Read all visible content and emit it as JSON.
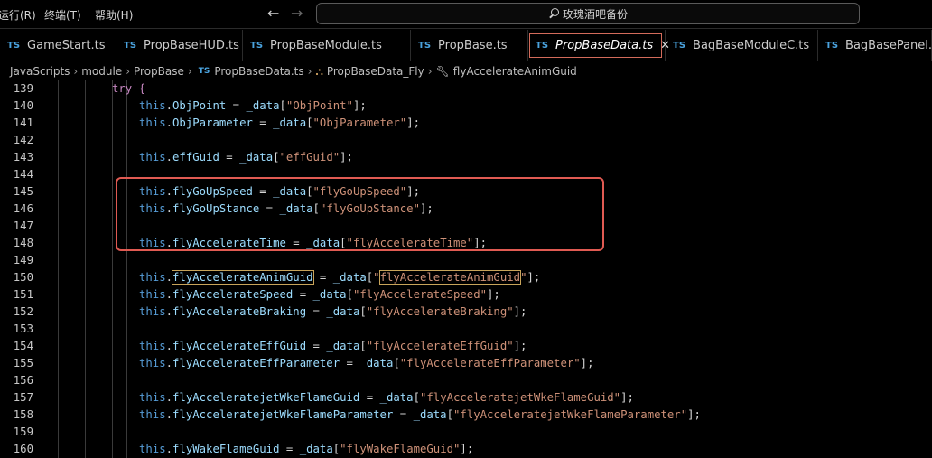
{
  "menu": {
    "run": "运行(R)",
    "terminal": "终端(T)",
    "help": "帮助(H)"
  },
  "search": {
    "text": "玫瑰酒吧备份"
  },
  "tabs": [
    {
      "label": "GameStart.ts",
      "active": false
    },
    {
      "label": "PropBaseHUD.ts",
      "active": false
    },
    {
      "label": "PropBaseModule.ts",
      "active": false
    },
    {
      "label": "PropBase.ts",
      "active": false
    },
    {
      "label": "PropBaseData.ts",
      "active": true
    },
    {
      "label": "BagBaseModuleC.ts",
      "active": false
    },
    {
      "label": "BagBasePanel.ts",
      "active": false
    }
  ],
  "tab_prefix": "TS",
  "close_glyph": "✕",
  "breadcrumb": {
    "items": [
      "JavaScripts",
      "module",
      "PropBase",
      "PropBaseData.ts",
      "PropBaseData_Fly",
      "flyAccelerateAnimGuid"
    ]
  },
  "editor": {
    "lines": [
      {
        "num": "139",
        "kind": "try",
        "text": "try {"
      },
      {
        "num": "140",
        "kind": "assign",
        "prop": "ObjPoint",
        "key": "\"ObjPoint\""
      },
      {
        "num": "141",
        "kind": "assign",
        "prop": "ObjParameter",
        "key": "\"ObjParameter\""
      },
      {
        "num": "142",
        "kind": "blank"
      },
      {
        "num": "143",
        "kind": "assign",
        "prop": "effGuid",
        "key": "\"effGuid\""
      },
      {
        "num": "144",
        "kind": "blank"
      },
      {
        "num": "145",
        "kind": "assign",
        "prop": "flyGoUpSpeed",
        "key": "\"flyGoUpSpeed\""
      },
      {
        "num": "146",
        "kind": "assign",
        "prop": "flyGoUpStance",
        "key": "\"flyGoUpStance\""
      },
      {
        "num": "147",
        "kind": "blank"
      },
      {
        "num": "148",
        "kind": "assign",
        "prop": "flyAccelerateTime",
        "key": "\"flyAccelerateTime\""
      },
      {
        "num": "149",
        "kind": "blank"
      },
      {
        "num": "150",
        "kind": "assign",
        "prop": "flyAccelerateAnimGuid",
        "key": "\"flyAccelerateAnimGuid\"",
        "selected": true
      },
      {
        "num": "151",
        "kind": "assign",
        "prop": "flyAccelerateSpeed",
        "key": "\"flyAccelerateSpeed\""
      },
      {
        "num": "152",
        "kind": "assign",
        "prop": "flyAccelerateBraking",
        "key": "\"flyAccelerateBraking\""
      },
      {
        "num": "153",
        "kind": "blank"
      },
      {
        "num": "154",
        "kind": "assign",
        "prop": "flyAccelerateEffGuid",
        "key": "\"flyAccelerateEffGuid\""
      },
      {
        "num": "155",
        "kind": "assign",
        "prop": "flyAccelerateEffParameter",
        "key": "\"flyAccelerateEffParameter\""
      },
      {
        "num": "156",
        "kind": "blank"
      },
      {
        "num": "157",
        "kind": "assign",
        "prop": "flyAcceleratejetWkeFlameGuid",
        "key": "\"flyAcceleratejetWkeFlameGuid\""
      },
      {
        "num": "158",
        "kind": "assign",
        "prop": "flyAcceleratejetWkeFlameParameter",
        "key": "\"flyAcceleratejetWkeFlameParameter\""
      },
      {
        "num": "159",
        "kind": "blank"
      },
      {
        "num": "160",
        "kind": "assign",
        "prop": "flyWakeFlameGuid",
        "key": "\"flyWakeFlameGuid\""
      }
    ],
    "this_keyword": "this",
    "data_var": "_data"
  },
  "colors": {
    "accent_ts": "#4aa3df",
    "annotation_box": "#e05a52",
    "string": "#ce9178",
    "keyword": "#569cd6"
  }
}
